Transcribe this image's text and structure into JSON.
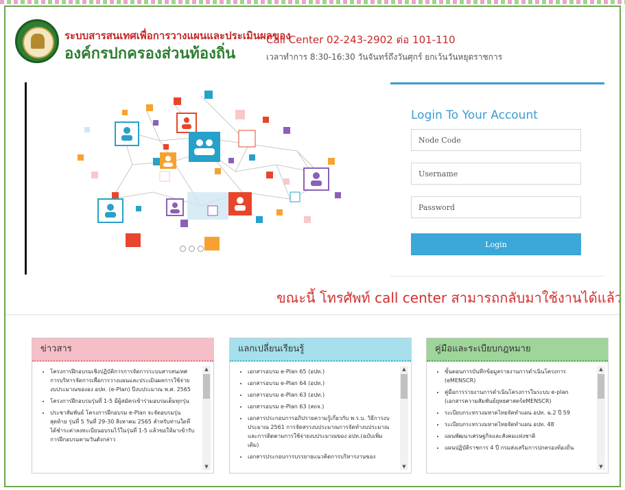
{
  "header": {
    "title_line1": "ระบบสารสนเทศเพื่อการวางแผนและประเมินผลของ",
    "title_line2": "องค์กรปกครองส่วนท้องถิ่น",
    "call_center": "Call Center 02-243-2902 ต่อ 101-110",
    "hours": "เวลาทำการ 8:30-16:30 วันจันทร์ถึงวันศุกร์ ยกเว้นวันหยุดราชการ"
  },
  "login": {
    "title": "Login To Your Account",
    "node_code_placeholder": "Node Code",
    "username_placeholder": "Username",
    "password_placeholder": "Password",
    "button_label": "Login"
  },
  "notice": "ขณะนี้ โทรศัพท์ call center สามารถกลับมาใช้งานได้แล้ว",
  "panels": [
    {
      "title": "ข่าวสาร",
      "header_color": "#f4bfc6",
      "items": [
        "โครงการฝึกอบรมเชิงปฏิบัติการการจัดการระบบสารสนเทศ การบริหารจัดการเพื่อการวางแผนและประเมินผลการใช้จ่ายงบประมาณขององ อปท. (e-Plan) ปีงบประมาณ พ.ศ. 2565",
        "โครงการฝึกอบรมรุ่นที่ 1-5 มีผู้สมัครเข้าร่วมอบรมเต็มทุกรุ่น",
        "ประชาสัมพันธ์ โครงการฝึกอบรม e-Plan จะจัดอบรมรุ่นสุดท้าย รุ่นที่ 5 วันที่ 29-30 สิงหาคม 2565 สำหรับท่านใดที่ได้ชำระค่าลงทะเบียนอบรมไว้ในรุ่นที่ 1-5 แล้วขอให้มาเข้ารับการฝึกอบรมตามวันดังกล่าว"
      ]
    },
    {
      "title": "แลกเปลี่ยนเรียนรู้",
      "header_color": "#a5e0ec",
      "items": [
        "เอกสารอบรม e-Plan 65 (อปท.)",
        "เอกสารอบรม e-Plan 64 (อปท.)",
        "เอกสารอบรม e-Plan 63 (อปท.)",
        "เอกสารอบรม e-Plan 63 (สถจ.)",
        "เอกสารประกอบการอภิปรายความรู้เกี่ยวกับ พ.ร.บ. วิธีการงบประมาณ 2561 การจัดสรรงบประมาณการจัดทำงบประมาณ และการติดตามการใช้จ่ายงบประมาณของ อปท.(ฉบับเพิ่มเติม)",
        "เอกสารประกอบการบรรยายแนวคิดการบริหารงานของ"
      ]
    },
    {
      "title": "คู่มือและระเบียบกฎหมาย",
      "header_color": "#9fd49a",
      "items": [
        "ขั้นตอนการบันทึกข้อมูลรายงานการดำเนินโครงการ (eMENSCR)",
        "คู่มือการรายงานการดำเนินโครงการในระบบ e-plan (เอกสารความสัมพันธ์ยุทธศาสตร์eMENSCR)",
        "ระเบียบกระทรวงมหาดไทยจัดทำแผน อปท. ฉ.2 ปี 59",
        "ระเบียบกระทรวงมหาดไทยจัดทำแผน อปท. 48",
        "แผนพัฒนาเศรษฐกิจและสังคมแห่งชาติ",
        "แผนปฏิบัติราชการ 4 ปี กรมส่งเสริมการปกครองท้องถิ่น"
      ]
    }
  ]
}
